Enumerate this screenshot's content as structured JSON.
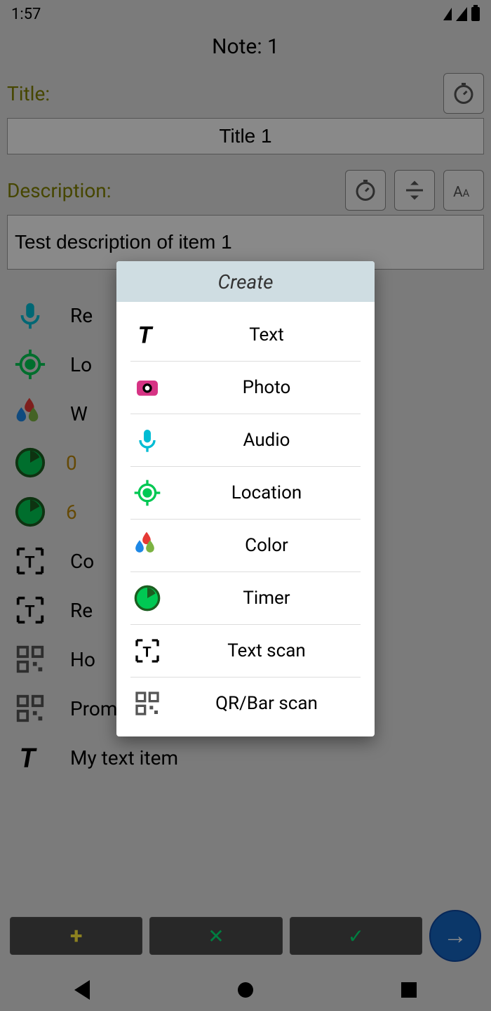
{
  "status": {
    "time": "1:57"
  },
  "header": {
    "title": "Note: 1"
  },
  "form": {
    "title_label": "Title:",
    "title_value": "Title 1",
    "description_label": "Description:",
    "description_value": "Test description of item 1"
  },
  "items": [
    {
      "icon": "mic-icon",
      "label": "Re",
      "color": "#00bcd4"
    },
    {
      "icon": "location-icon",
      "label": "Lo",
      "color": "#00c853"
    },
    {
      "icon": "color-icon",
      "label": "W",
      "color": ""
    },
    {
      "icon": "timer-icon",
      "label": "0",
      "color": "#00c853",
      "numeric": true
    },
    {
      "icon": "timer-icon",
      "label": "6",
      "color": "#00c853",
      "numeric": true
    },
    {
      "icon": "textscan-icon",
      "label": "Co",
      "color": "#000"
    },
    {
      "icon": "textscan-icon",
      "label": "Re",
      "color": "#000"
    },
    {
      "icon": "qr-icon",
      "label": "Ho",
      "color": "#555"
    },
    {
      "icon": "qr-icon",
      "label": "Promo code",
      "color": "#555"
    },
    {
      "icon": "text-icon",
      "label": "My text item",
      "color": "#000"
    }
  ],
  "dialog": {
    "title": "Create",
    "options": [
      {
        "label": "Text",
        "icon": "text-icon"
      },
      {
        "label": "Photo",
        "icon": "photo-icon"
      },
      {
        "label": "Audio",
        "icon": "mic-icon"
      },
      {
        "label": "Location",
        "icon": "location-icon"
      },
      {
        "label": "Color",
        "icon": "color-icon"
      },
      {
        "label": "Timer",
        "icon": "timer-icon"
      },
      {
        "label": "Text scan",
        "icon": "textscan-icon"
      },
      {
        "label": "QR/Bar scan",
        "icon": "qr-icon"
      }
    ]
  },
  "colors": {
    "accent": "#1565c0"
  }
}
